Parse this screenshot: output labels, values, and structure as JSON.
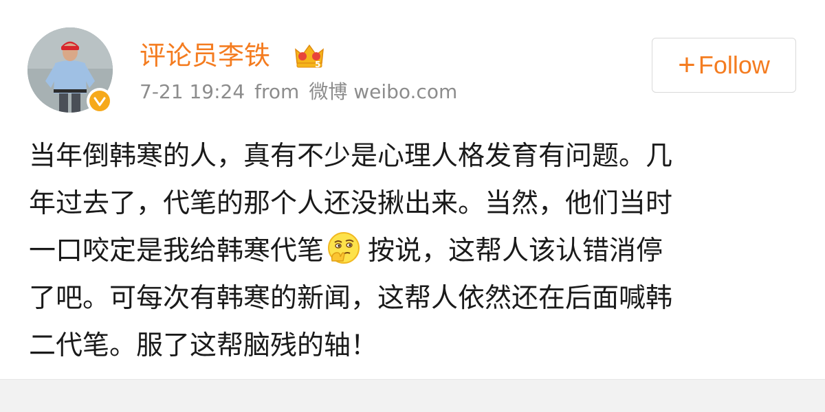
{
  "post": {
    "author": {
      "name": "评论员李铁",
      "verified": true,
      "vip_icon": "crown-vip-icon"
    },
    "timestamp": "7-21 19:24",
    "source_prefix": "from",
    "source": "微博 weibo.com",
    "follow": {
      "plus": "+",
      "label": "Follow"
    },
    "text_lines": [
      "当年倒韩寒的人，真有不少是心理人格发育有问题。几",
      "年过去了，代笔的那个人还没揪出来。当然，他们当时",
      "一口咬定是我给韩寒代笔",
      "按说，这帮人该认错消停",
      "了吧。可每次有韩寒的新闻，这帮人依然还在后面喊韩",
      "二代笔。服了这帮脑残的轴！"
    ],
    "inline_emoji": "thinking-face-emoji"
  },
  "colors": {
    "accent": "#f47c20",
    "meta_text": "#8c8c8c",
    "body_text": "#1a1a1a",
    "verified": "#f6a91b",
    "bottom_strip": "#f2f2f2"
  }
}
